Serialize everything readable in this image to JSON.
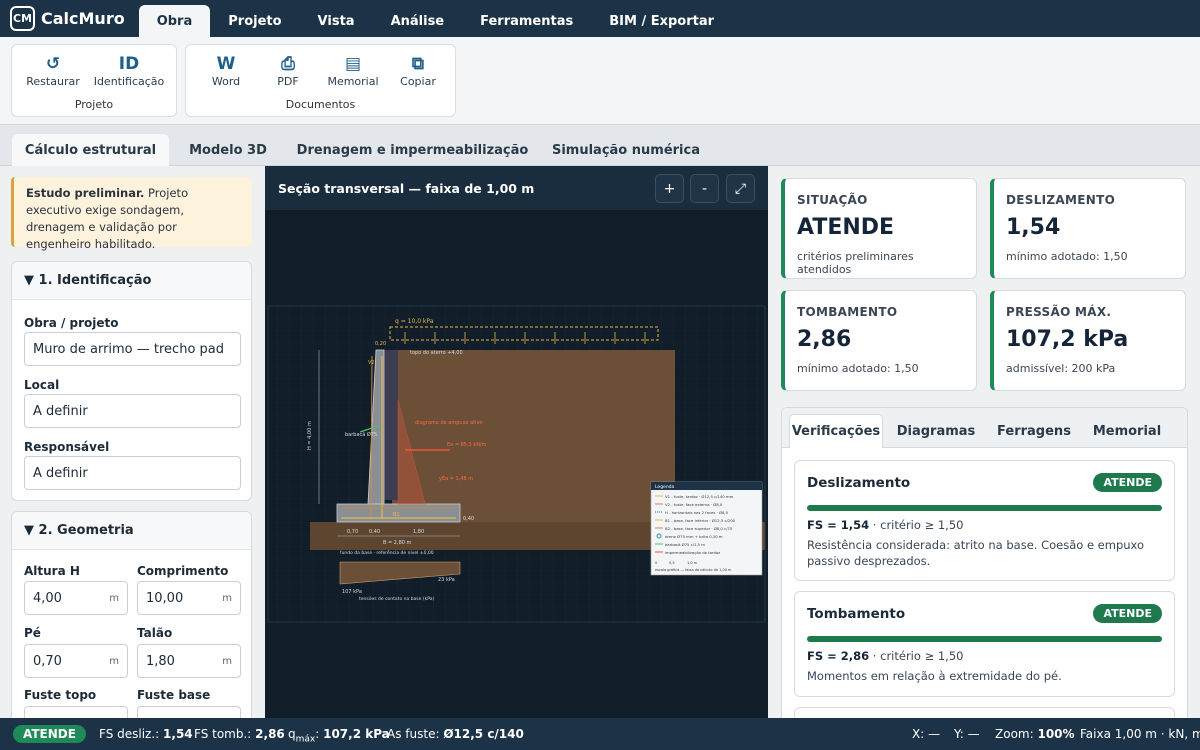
{
  "app": {
    "logo": "CM",
    "name": "CalcMuro"
  },
  "menu": [
    "Obra",
    "Projeto",
    "Vista",
    "Análise",
    "Ferramentas",
    "BIM / Exportar"
  ],
  "ribbon": {
    "projeto": {
      "label": "Projeto",
      "buttons": [
        {
          "icon": "↺",
          "label": "Restaurar"
        },
        {
          "icon": "ID",
          "label": "Identificação"
        }
      ]
    },
    "documentos": {
      "label": "Documentos",
      "buttons": [
        {
          "icon": "W",
          "label": "Word"
        },
        {
          "icon": "⎙",
          "label": "PDF"
        },
        {
          "icon": "▤",
          "label": "Memorial"
        },
        {
          "icon": "⧉",
          "label": "Copiar"
        }
      ]
    }
  },
  "tabs": [
    "Cálculo estrutural",
    "Modelo 3D",
    "Drenagem e impermeabilização",
    "Simulação numérica"
  ],
  "note": {
    "bold": "Estudo preliminar.",
    "text": "Projeto executivo exige sondagem, drenagem e validação por engenheiro habilitado."
  },
  "ident": {
    "title": "▼ 1. Identificação",
    "obra_label": "Obra / projeto",
    "obra_value": "Muro de arrimo — trecho pad",
    "local_label": "Local",
    "local_value": "A definir",
    "resp_label": "Responsável",
    "resp_value": "A definir"
  },
  "geom": {
    "title": "▼ 2. Geometria",
    "fields": [
      {
        "label": "Altura H",
        "value": "4,00",
        "unit": "m"
      },
      {
        "label": "Comprimento",
        "value": "10,00",
        "unit": "m"
      },
      {
        "label": "Pé",
        "value": "0,70",
        "unit": "m"
      },
      {
        "label": "Talão",
        "value": "1,80",
        "unit": "m"
      },
      {
        "label": "Fuste topo",
        "value": "",
        "unit": ""
      },
      {
        "label": "Fuste base",
        "value": "",
        "unit": ""
      }
    ]
  },
  "section": {
    "title": "Seção transversal — faixa de 1,00 m",
    "zoom_in": "+",
    "zoom_out": "-",
    "fullscreen": "⤢",
    "labels": {
      "q": "q = 10,0 kPa",
      "topo": "topo do aterro +4,00",
      "H": "H = 4,00 m",
      "diag": "diagrama de empuxo ativo",
      "ea": "Ea = 65,3 kN/m",
      "barbaca": "barbacã Ø75",
      "yea": "yEa = 1,48 m",
      "fundo": "fundo da base · referência de nível ±0,00",
      "B": "B = 2,80 m",
      "p1": "0,70",
      "p2": "0,40",
      "p3": "1,80",
      "tensoes": "tensões de contato na base (kPa)",
      "qmax": "107 kPa",
      "qmin": "23 kPa",
      "w": "0,20",
      "hb": "0,40",
      "V2": "V2",
      "B1": "B1"
    },
    "legend": [
      "V1 - fuste, tardoz · Ø12,5 c/140 mm",
      "V2 - fuste, face externa · Ø8,0",
      "H - horizontais nas 2 faces · Ø8,0",
      "B1 - base, face inferior · Ø12,5 c/200",
      "B2 - base, face superior · Ø8,0 c/75",
      "dreno Ø75 mm + brita 0,30 m",
      "barbacã Ø75 c/1,5 m",
      "impermeabilização do tardoz"
    ],
    "legend_title": "Legenda",
    "legend_scale": "escala gráfica — faixa de cálculo de 1,00 m",
    "scale_ticks": [
      "0",
      "0,5",
      "1,0 m"
    ]
  },
  "kpis": [
    {
      "label": "SITUAÇÃO",
      "value": "ATENDE",
      "sub": "critérios preliminares atendidos"
    },
    {
      "label": "DESLIZAMENTO",
      "value": "1,54",
      "sub": "mínimo adotado: 1,50"
    },
    {
      "label": "TOMBAMENTO",
      "value": "2,86",
      "sub": "mínimo adotado: 1,50"
    },
    {
      "label": "PRESSÃO MÁX.",
      "value": "107,2 kPa",
      "sub": "admissível: 200 kPa"
    }
  ],
  "vtabs": [
    "Verificações",
    "Diagramas",
    "Ferragens",
    "Memorial"
  ],
  "checks": [
    {
      "title": "Deslizamento",
      "badge": "ATENDE",
      "fs_label": "FS = 1,54",
      "crit": " · critério ≥ 1,50",
      "desc": "Resistência considerada: atrito na base. Coesão e empuxo passivo desprezados."
    },
    {
      "title": "Tombamento",
      "badge": "ATENDE",
      "fs_label": "FS = 2,86",
      "crit": " · critério ≥ 1,50",
      "desc": "Momentos em relação à extremidade do pé."
    }
  ],
  "status": {
    "badge": "ATENDE",
    "desliz_label": "FS desliz.:",
    "desliz": "1,54",
    "tomb_label": "FS tomb.:",
    "tomb": "2,86",
    "q_label": "q",
    "q_sub": "máx",
    "q_value": "107,2 kPa",
    "as_label": "As fuste:",
    "as": "Ø12,5 c/140",
    "x": "X: —",
    "y": "Y: —",
    "zoom_label": "Zoom:",
    "zoom": "100%",
    "faixa": "Faixa 1,00 m · kN, m"
  },
  "colors": {
    "primary": "#1b3247",
    "ok": "#1e8a57",
    "soil": "#6b4f36",
    "rebar": "#e8b84a",
    "note": "#fdf2dc"
  }
}
